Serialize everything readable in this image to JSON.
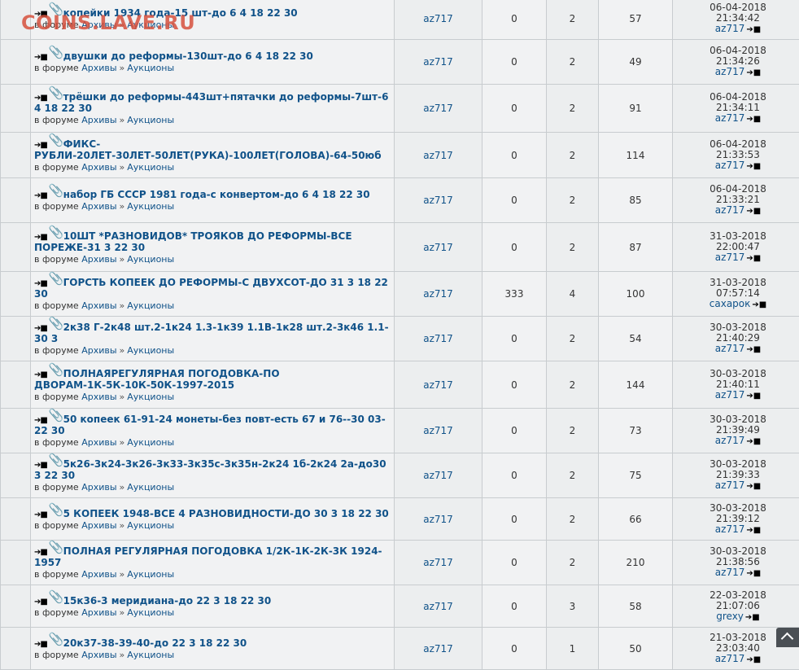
{
  "watermark": "COINS.LAVE.RU",
  "forum_prefix": "в форуме",
  "forum_name": "Архивы",
  "subforum_name": "Аукционы",
  "separator": "»",
  "rows": [
    {
      "title": "копейки 1934 года-15 шт-до 6 4 18 22 30",
      "author": "az717",
      "replies": "0",
      "views_a": "2",
      "views": "57",
      "date": "06-04-2018",
      "time": "21:34:42",
      "last_user": "az717"
    },
    {
      "title": "двушки до реформы-130шт-до 6 4 18 22 30",
      "author": "az717",
      "replies": "0",
      "views_a": "2",
      "views": "49",
      "date": "06-04-2018",
      "time": "21:34:26",
      "last_user": "az717"
    },
    {
      "title": "трёшки до реформы-443шт+пятачки до реформы-7шт-6 4 18 22 30",
      "author": "az717",
      "replies": "0",
      "views_a": "2",
      "views": "91",
      "date": "06-04-2018",
      "time": "21:34:11",
      "last_user": "az717"
    },
    {
      "title": "ФИКС-РУБЛИ-20ЛЕТ-30ЛЕТ-50ЛЕТ(РУКА)-100ЛЕТ(ГОЛОВА)-64-50юб",
      "author": "az717",
      "replies": "0",
      "views_a": "2",
      "views": "114",
      "date": "06-04-2018",
      "time": "21:33:53",
      "last_user": "az717"
    },
    {
      "title": "набор ГБ СССР 1981 года-с конвертом-до 6 4 18 22 30",
      "author": "az717",
      "replies": "0",
      "views_a": "2",
      "views": "85",
      "date": "06-04-2018",
      "time": "21:33:21",
      "last_user": "az717"
    },
    {
      "title": "10ШТ *РАЗНОВИДОВ* ТРОЯКОВ ДО РЕФОРМЫ-ВСЕ ПОРЕЖЕ-31 3 22 30",
      "author": "az717",
      "replies": "0",
      "views_a": "2",
      "views": "87",
      "date": "31-03-2018",
      "time": "22:00:47",
      "last_user": "az717"
    },
    {
      "title": "ГОРСТЬ КОПЕЕК ДО РЕФОРМЫ-С ДВУХСОТ-ДО 31 3 18 22 30",
      "author": "az717",
      "replies": "333",
      "views_a": "4",
      "views": "100",
      "date": "31-03-2018",
      "time": "07:57:14",
      "last_user": "сахарок"
    },
    {
      "title": "2к38 Г-2к48 шт.2-1к24 1.3-1к39 1.1В-1к28 шт.2-3к46 1.1-30 3",
      "author": "az717",
      "replies": "0",
      "views_a": "2",
      "views": "54",
      "date": "30-03-2018",
      "time": "21:40:29",
      "last_user": "az717"
    },
    {
      "title": "ПОЛНАЯРЕГУЛЯРНАЯ ПОГОДОВКА-ПО ДВОРАМ-1К-5К-10К-50К-1997-2015",
      "author": "az717",
      "replies": "0",
      "views_a": "2",
      "views": "144",
      "date": "30-03-2018",
      "time": "21:40:11",
      "last_user": "az717"
    },
    {
      "title": "50 копеек 61-91-24 монеты-без повт-есть 67 и 76--30 03-22 30",
      "author": "az717",
      "replies": "0",
      "views_a": "2",
      "views": "73",
      "date": "30-03-2018",
      "time": "21:39:49",
      "last_user": "az717"
    },
    {
      "title": "5к26-3к24-3к26-3к33-3к35с-3к35н-2к24 1б-2к24 2а-до30 3 22 30",
      "author": "az717",
      "replies": "0",
      "views_a": "2",
      "views": "75",
      "date": "30-03-2018",
      "time": "21:39:33",
      "last_user": "az717"
    },
    {
      "title": "5 КОПЕЕК 1948-ВСЕ 4 РАЗНОВИДНОСТИ-ДО 30 3 18 22 30",
      "author": "az717",
      "replies": "0",
      "views_a": "2",
      "views": "66",
      "date": "30-03-2018",
      "time": "21:39:12",
      "last_user": "az717"
    },
    {
      "title": "ПОЛНАЯ РЕГУЛЯРНАЯ ПОГОДОВКА 1/2К-1К-2К-3К 1924-1957",
      "author": "az717",
      "replies": "0",
      "views_a": "2",
      "views": "210",
      "date": "30-03-2018",
      "time": "21:38:56",
      "last_user": "az717"
    },
    {
      "title": "15к36-3 меридиана-до 22 3 18 22 30",
      "author": "az717",
      "replies": "0",
      "views_a": "3",
      "views": "58",
      "date": "22-03-2018",
      "time": "21:07:06",
      "last_user": "grexy"
    },
    {
      "title": "20к37-38-39-40-до 22 3 18 22 30",
      "author": "az717",
      "replies": "0",
      "views_a": "1",
      "views": "50",
      "date": "21-03-2018",
      "time": "23:03:40",
      "last_user": "az717"
    }
  ]
}
